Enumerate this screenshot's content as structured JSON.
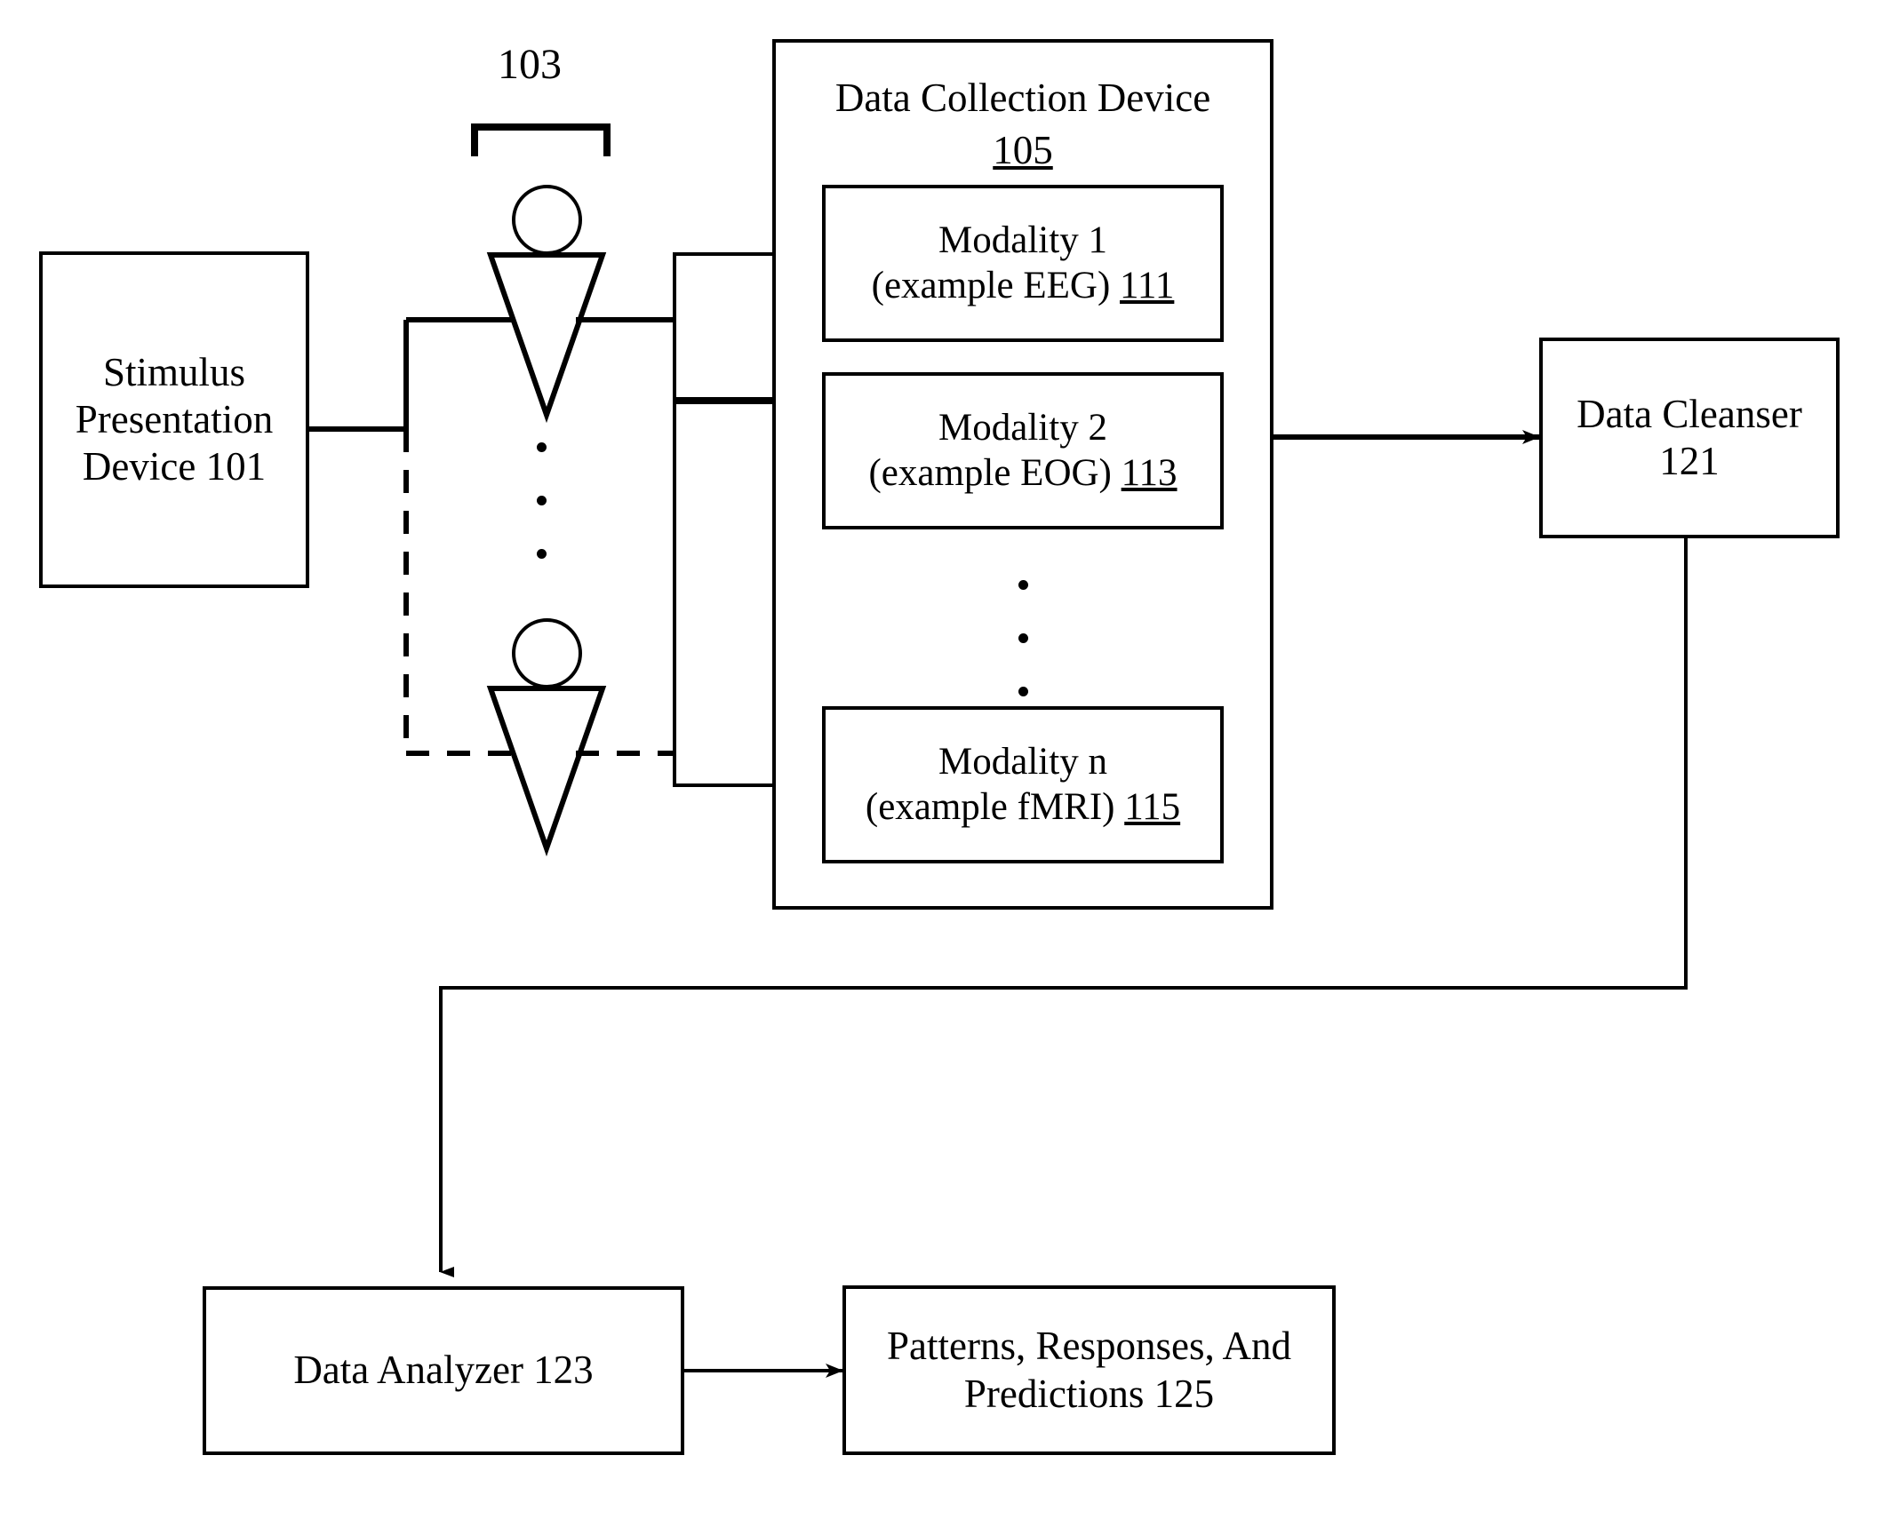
{
  "figure": {
    "type": "patent-block-diagram",
    "background": "#ffffff",
    "stroke_color": "#000000"
  },
  "labels": {
    "bracket_ref": "103"
  },
  "nodes": {
    "stimulus": {
      "name": "stimulus-presentation-device",
      "text": "Stimulus\nPresentation\nDevice 101"
    },
    "data_collection": {
      "name": "data-collection-device",
      "title": "Data Collection Device",
      "ref": "105"
    },
    "modality1": {
      "name": "modality-1",
      "line1": "Modality 1",
      "line2_prefix": "(example EEG) ",
      "ref": "111"
    },
    "modality2": {
      "name": "modality-2",
      "line1": "Modality 2",
      "line2_prefix": "(example EOG) ",
      "ref": "113"
    },
    "modalityn": {
      "name": "modality-n",
      "line1": "Modality n",
      "line2_prefix": "(example fMRI) ",
      "ref": "115"
    },
    "data_cleanser": {
      "name": "data-cleanser",
      "text": "Data Cleanser\n121"
    },
    "data_analyzer": {
      "name": "data-analyzer",
      "text": "Data Analyzer 123"
    },
    "outputs": {
      "name": "patterns-responses-predictions",
      "text": "Patterns, Responses, And\nPredictions 125"
    }
  },
  "ellipses": {
    "subjects_vertical": "•••",
    "modalities_vertical": "•••"
  },
  "subjects": [
    {
      "name": "subject-1",
      "connection": "solid"
    },
    {
      "name": "subject-n",
      "connection": "dashed"
    }
  ],
  "edges": [
    {
      "name": "stimulus-to-subject-1",
      "style": "solid",
      "arrow": true
    },
    {
      "name": "stimulus-to-subject-n",
      "style": "dashed",
      "arrow": true
    },
    {
      "name": "subject-1-to-collector",
      "style": "solid",
      "arrow": false
    },
    {
      "name": "subject-n-to-collector",
      "style": "dashed",
      "arrow": false
    },
    {
      "name": "collector-to-cleanser",
      "style": "solid",
      "arrow": true
    },
    {
      "name": "cleanser-to-analyzer",
      "style": "solid",
      "arrow": true
    },
    {
      "name": "analyzer-to-outputs",
      "style": "solid",
      "arrow": true
    }
  ]
}
